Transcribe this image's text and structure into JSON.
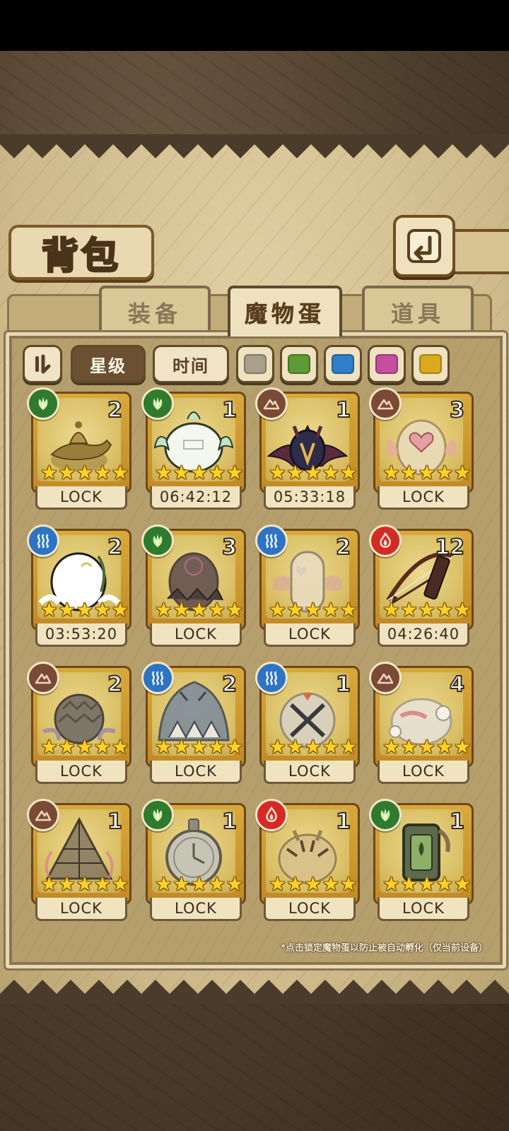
{
  "header": {
    "title": "背包"
  },
  "tabs": [
    {
      "label": "装备"
    },
    {
      "label": "魔物蛋"
    },
    {
      "label": "道具"
    }
  ],
  "filters": {
    "sort_star": "星级",
    "sort_time": "时间",
    "swatches": [
      "#a9a08c",
      "#5f9a34",
      "#2f7fc8",
      "#c44ea0",
      "#d9aa1e"
    ]
  },
  "eggs": [
    {
      "element": "nature",
      "count": "2",
      "status": "LOCK",
      "art": "lamp"
    },
    {
      "element": "nature",
      "count": "1",
      "status": "06:42:12",
      "art": "white"
    },
    {
      "element": "earth",
      "count": "1",
      "status": "05:33:18",
      "art": "bat"
    },
    {
      "element": "earth",
      "count": "3",
      "status": "LOCK",
      "art": "heart"
    },
    {
      "element": "water",
      "count": "2",
      "status": "03:53:20",
      "art": "whiteegg"
    },
    {
      "element": "nature",
      "count": "3",
      "status": "LOCK",
      "art": "dark"
    },
    {
      "element": "water",
      "count": "2",
      "status": "LOCK",
      "art": "fairy"
    },
    {
      "element": "fire",
      "count": "12",
      "status": "04:26:40",
      "art": "bow"
    },
    {
      "element": "earth",
      "count": "2",
      "status": "LOCK",
      "art": "pine"
    },
    {
      "element": "water",
      "count": "2",
      "status": "LOCK",
      "art": "shell"
    },
    {
      "element": "water",
      "count": "1",
      "status": "LOCK",
      "art": "cross"
    },
    {
      "element": "earth",
      "count": "4",
      "status": "LOCK",
      "art": "flower"
    },
    {
      "element": "earth",
      "count": "1",
      "status": "LOCK",
      "art": "pyramid"
    },
    {
      "element": "nature",
      "count": "1",
      "status": "LOCK",
      "art": "watch"
    },
    {
      "element": "fire",
      "count": "1",
      "status": "LOCK",
      "art": "tiger"
    },
    {
      "element": "nature",
      "count": "1",
      "status": "LOCK",
      "art": "lantern"
    }
  ],
  "footnote": "*点击锁定魔物蛋以防止被自动孵化（仅当前设备）"
}
